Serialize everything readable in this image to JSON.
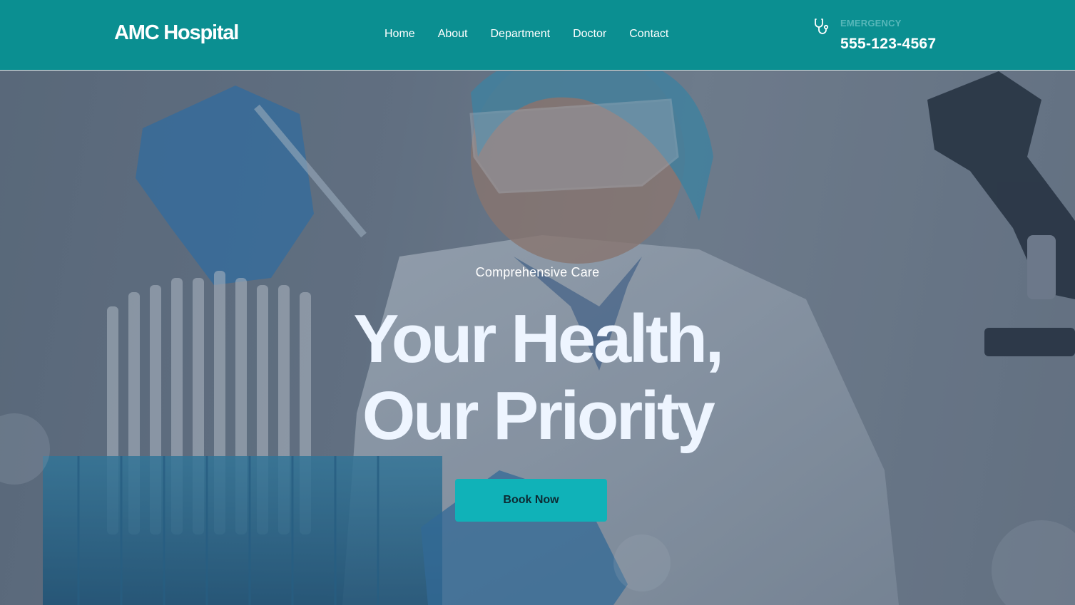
{
  "header": {
    "brand": "AMC Hospital",
    "nav": [
      "Home",
      "About",
      "Department",
      "Doctor",
      "Contact"
    ],
    "emergency": {
      "label": "EMERGENCY",
      "phone": "555-123-4567",
      "icon": "stethoscope-icon"
    }
  },
  "hero": {
    "eyebrow": "Comprehensive Care",
    "headline_line1": "Your Health,",
    "headline_line2": "Our Priority",
    "cta": "Book Now"
  },
  "colors": {
    "header_bg": "#0b8f91",
    "cta_bg": "#10b2b8",
    "emergency_label": "#57b7b9"
  }
}
